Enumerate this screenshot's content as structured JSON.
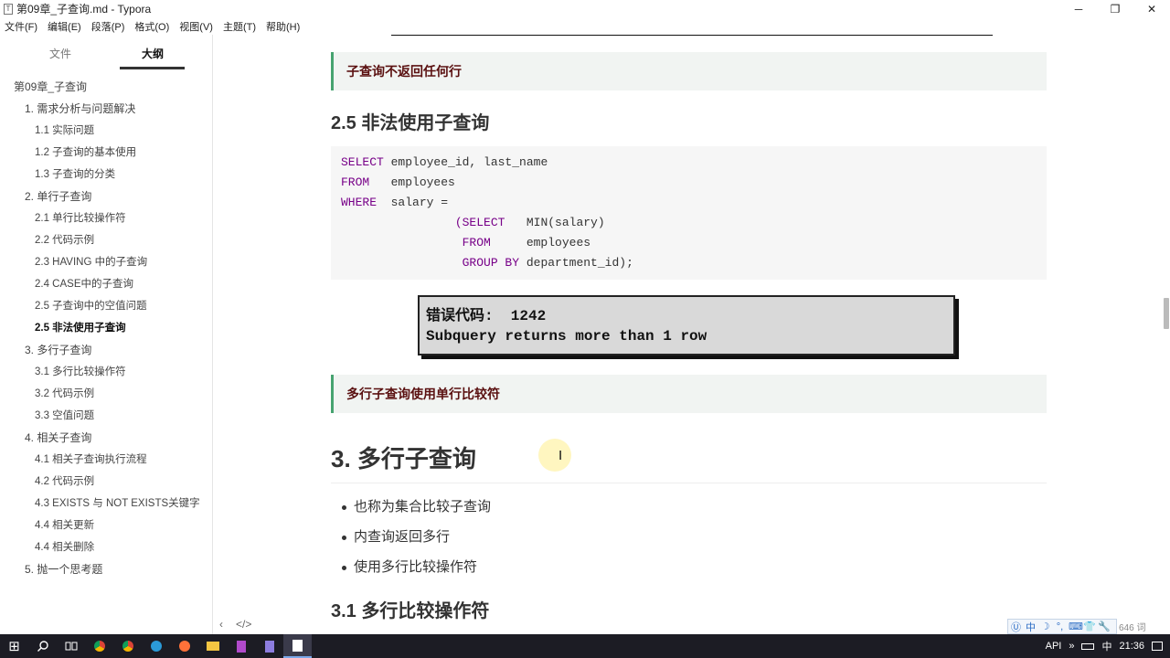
{
  "window": {
    "title": "第09章_子查询.md - Typora",
    "minimize": "─",
    "maximize": "❐",
    "close": "✕"
  },
  "menu": [
    "文件(F)",
    "编辑(E)",
    "段落(P)",
    "格式(O)",
    "视图(V)",
    "主题(T)",
    "帮助(H)"
  ],
  "sidebar": {
    "tab_files": "文件",
    "tab_outline": "大纲",
    "outline": [
      {
        "label": "第09章_子查询",
        "level": 1
      },
      {
        "label": "1. 需求分析与问题解决",
        "level": 2
      },
      {
        "label": "1.1 实际问题",
        "level": 3
      },
      {
        "label": "1.2 子查询的基本使用",
        "level": 3
      },
      {
        "label": "1.3 子查询的分类",
        "level": 3
      },
      {
        "label": "2. 单行子查询",
        "level": 2
      },
      {
        "label": "2.1 单行比较操作符",
        "level": 3
      },
      {
        "label": "2.2 代码示例",
        "level": 3
      },
      {
        "label": "2.3 HAVING 中的子查询",
        "level": 3
      },
      {
        "label": "2.4 CASE中的子查询",
        "level": 3
      },
      {
        "label": "2.5 子查询中的空值问题",
        "level": 3
      },
      {
        "label": "2.5 非法使用子查询",
        "level": 3,
        "active": true
      },
      {
        "label": "3. 多行子查询",
        "level": 2
      },
      {
        "label": "3.1 多行比较操作符",
        "level": 3
      },
      {
        "label": "3.2 代码示例",
        "level": 3
      },
      {
        "label": "3.3 空值问题",
        "level": 3
      },
      {
        "label": "4. 相关子查询",
        "level": 2
      },
      {
        "label": "4.1 相关子查询执行流程",
        "level": 3
      },
      {
        "label": "4.2 代码示例",
        "level": 3
      },
      {
        "label": "4.3 EXISTS 与 NOT EXISTS关键字",
        "level": 3
      },
      {
        "label": "4.4 相关更新",
        "level": 3
      },
      {
        "label": "4.4 相关删除",
        "level": 3
      },
      {
        "label": "5. 抛一个思考题",
        "level": 2
      }
    ],
    "footer_back": "‹",
    "footer_source": "</>"
  },
  "main": {
    "callout1": "子查询不返回任何行",
    "heading_25": "2.5 非法使用子查询",
    "code_lines": [
      [
        {
          "t": "SELECT",
          "kw": true
        },
        {
          "t": " employee_id, last_name"
        }
      ],
      [
        {
          "t": "FROM",
          "kw": true
        },
        {
          "t": "   employees"
        }
      ],
      [
        {
          "t": "WHERE",
          "kw": true
        },
        {
          "t": "  salary ="
        }
      ],
      [
        {
          "t": "                (SELECT",
          "kw": true
        },
        {
          "t": "   MIN(salary)"
        }
      ],
      [
        {
          "t": "                 FROM",
          "kw": true
        },
        {
          "t": "     employees"
        }
      ],
      [
        {
          "t": "                 GROUP BY",
          "kw": true
        },
        {
          "t": " department_id);"
        }
      ]
    ],
    "error_line1": "错误代码:  1242",
    "error_line2": "Subquery returns more than 1 row",
    "callout2": "多行子查询使用单行比较符",
    "heading_3": "3. 多行子查询",
    "bullets": [
      "也称为集合比较子查询",
      "内查询返回多行",
      "使用多行比较操作符"
    ],
    "heading_31": "3.1 多行比较操作符",
    "word_count": "646 词",
    "ibeam": "I"
  },
  "ime": [
    "Ⓤ",
    "中",
    "☽",
    "°,",
    "⌨",
    "👕",
    "🔧"
  ],
  "taskbar": {
    "start_icon": "⊞",
    "tray_api": "API",
    "tray_chevron": "»",
    "tray_ime": "中",
    "time": "21:36",
    "icons": [
      "search-icon",
      "task-view-icon",
      "chrome-icon",
      "chrome-icon-2",
      "edge-icon",
      "firefox-icon",
      "explorer-icon",
      "app-icon",
      "app-icon-2",
      "typora-icon"
    ]
  }
}
